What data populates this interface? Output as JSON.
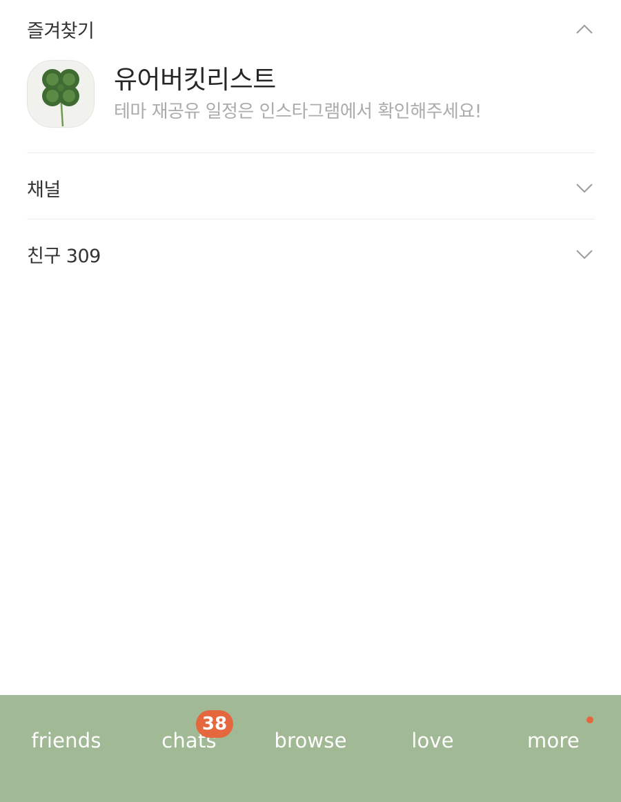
{
  "favorites": {
    "title": "즐겨찾기",
    "chevron_icon": "chevron-up-icon",
    "item": {
      "name": "유어버킷리스트",
      "status": "테마 재공유 일정은 인스타그램에서 확인해주세요!",
      "avatar_icon": "four-leaf-clover-icon"
    }
  },
  "channel": {
    "title": "채널",
    "chevron_icon": "chevron-down-icon"
  },
  "friends_section": {
    "title": "친구 309",
    "chevron_icon": "chevron-down-icon"
  },
  "tabbar": {
    "tabs": [
      {
        "label": "friends"
      },
      {
        "label": "chats"
      },
      {
        "label": "browse"
      },
      {
        "label": "love"
      },
      {
        "label": "more"
      }
    ],
    "chats_badge": "38",
    "more_has_notification_dot": true
  },
  "colors": {
    "tabbar_bg": "#a2b996",
    "badge": "#e4673d",
    "secondary_text": "#ababab"
  }
}
